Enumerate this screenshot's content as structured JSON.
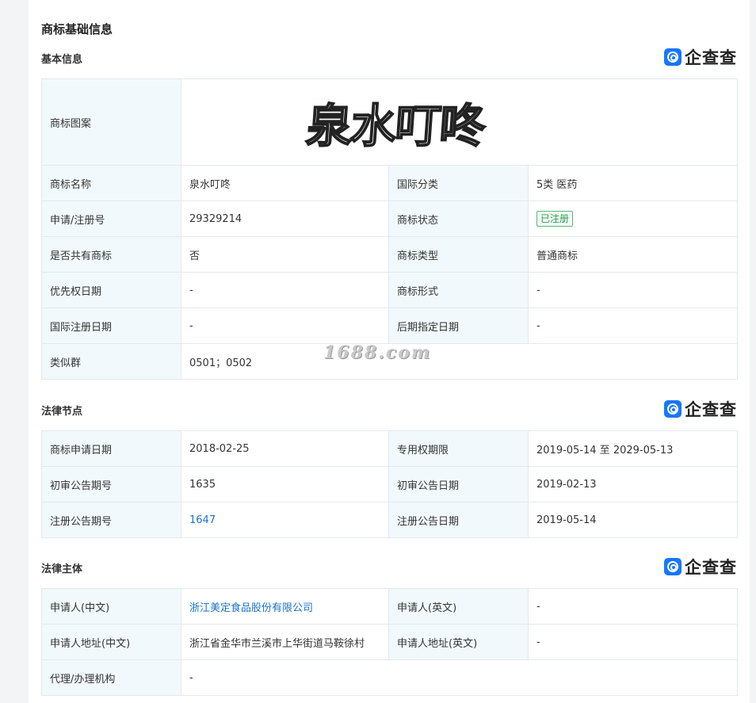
{
  "page_title": "商标基础信息",
  "brand_logo_text": "企查查",
  "basic": {
    "section_title": "基本信息",
    "tm_image_label": "商标图案",
    "tm_image_text": "泉水叮咚",
    "name_label": "商标名称",
    "name_value": "泉水叮咚",
    "intl_class_label": "国际分类",
    "intl_class_value": "5类 医药",
    "reg_no_label": "申请/注册号",
    "reg_no_value": "29329214",
    "status_label": "商标状态",
    "status_value": "已注册",
    "shared_label": "是否共有商标",
    "shared_value": "否",
    "type_label": "商标类型",
    "type_value": "普通商标",
    "priority_label": "优先权日期",
    "priority_value": "-",
    "form_label": "商标形式",
    "form_value": "-",
    "intl_reg_label": "国际注册日期",
    "intl_reg_value": "-",
    "later_label": "后期指定日期",
    "later_value": "-",
    "similar_label": "类似群",
    "similar_value": "0501；0502"
  },
  "legal": {
    "section_title": "法律节点",
    "apply_date_label": "商标申请日期",
    "apply_date_value": "2018-02-25",
    "excl_label": "专用权期限",
    "excl_value": "2019-05-14 至 2029-05-13",
    "prelim_no_label": "初审公告期号",
    "prelim_no_value": "1635",
    "prelim_date_label": "初审公告日期",
    "prelim_date_value": "2019-02-13",
    "reg_no_label": "注册公告期号",
    "reg_no_value": "1647",
    "reg_date_label": "注册公告日期",
    "reg_date_value": "2019-05-14"
  },
  "subject": {
    "section_title": "法律主体",
    "applicant_cn_label": "申请人(中文)",
    "applicant_cn_value": "浙江美定食品股份有限公司",
    "applicant_en_label": "申请人(英文)",
    "applicant_en_value": "-",
    "addr_cn_label": "申请人地址(中文)",
    "addr_cn_value": "浙江省金华市兰溪市上华街道马鞍徐村",
    "addr_en_label": "申请人地址(英文)",
    "addr_en_value": "-",
    "agent_label": "代理/办理机构",
    "agent_value": "-"
  },
  "watermark": "1688.com",
  "colors": {
    "label_bg": "#f2f9fc",
    "link": "#1a73c7",
    "status_green": "#2d9b55",
    "brand_blue": "#1677ff"
  }
}
